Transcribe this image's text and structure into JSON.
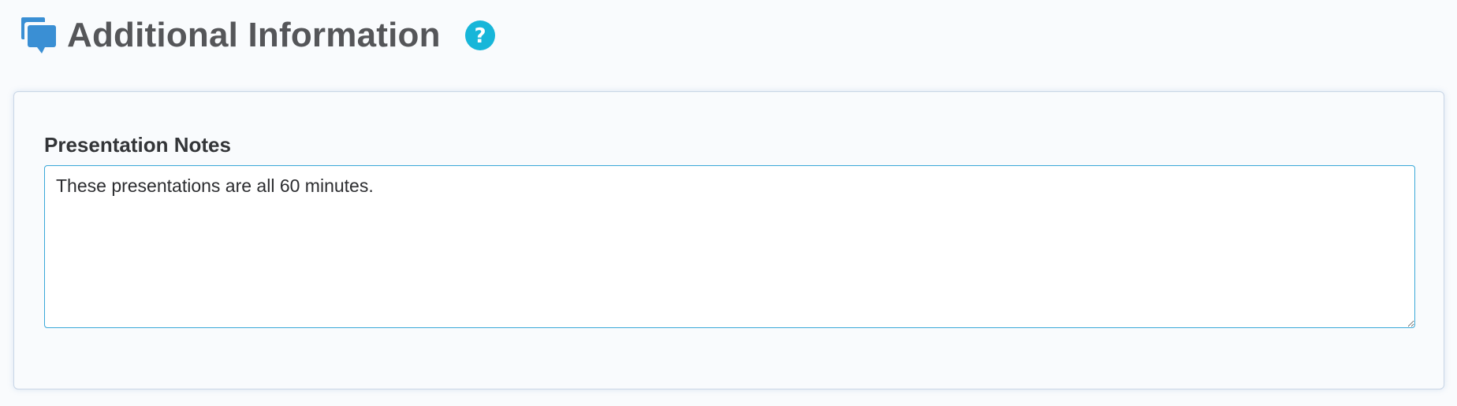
{
  "header": {
    "title": "Additional Information",
    "title_icon": "chat-bubbles-icon",
    "help_icon": "question-circle-icon"
  },
  "panel": {
    "field_label": "Presentation Notes",
    "notes_value": "These presentations are all 60 minutes."
  },
  "colors": {
    "icon_blue": "#3a8fd4",
    "help_cyan": "#17b6d9",
    "title_gray": "#555659",
    "textarea_border": "#3aa8d8"
  }
}
